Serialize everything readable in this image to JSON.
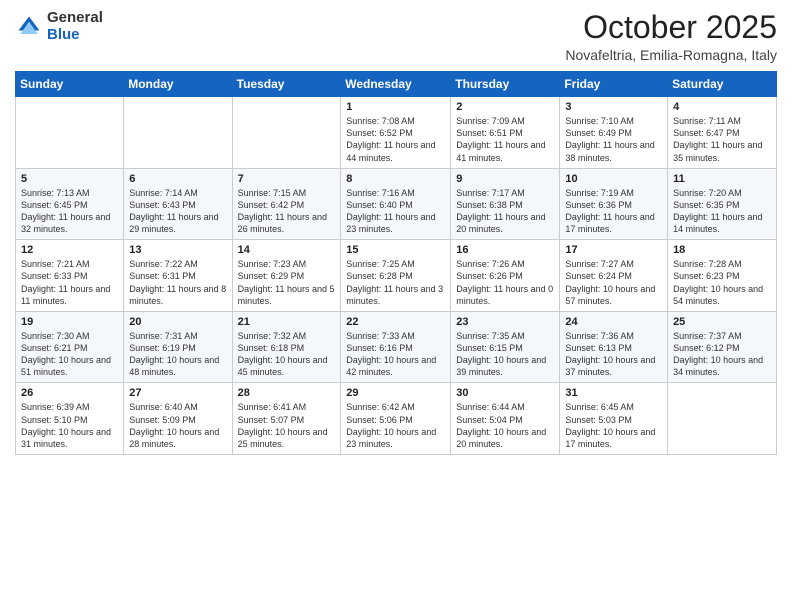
{
  "logo": {
    "general": "General",
    "blue": "Blue"
  },
  "header": {
    "month": "October 2025",
    "location": "Novafeltria, Emilia-Romagna, Italy"
  },
  "days_of_week": [
    "Sunday",
    "Monday",
    "Tuesday",
    "Wednesday",
    "Thursday",
    "Friday",
    "Saturday"
  ],
  "weeks": [
    [
      {
        "day": "",
        "content": ""
      },
      {
        "day": "",
        "content": ""
      },
      {
        "day": "",
        "content": ""
      },
      {
        "day": "1",
        "content": "Sunrise: 7:08 AM\nSunset: 6:52 PM\nDaylight: 11 hours and 44 minutes."
      },
      {
        "day": "2",
        "content": "Sunrise: 7:09 AM\nSunset: 6:51 PM\nDaylight: 11 hours and 41 minutes."
      },
      {
        "day": "3",
        "content": "Sunrise: 7:10 AM\nSunset: 6:49 PM\nDaylight: 11 hours and 38 minutes."
      },
      {
        "day": "4",
        "content": "Sunrise: 7:11 AM\nSunset: 6:47 PM\nDaylight: 11 hours and 35 minutes."
      }
    ],
    [
      {
        "day": "5",
        "content": "Sunrise: 7:13 AM\nSunset: 6:45 PM\nDaylight: 11 hours and 32 minutes."
      },
      {
        "day": "6",
        "content": "Sunrise: 7:14 AM\nSunset: 6:43 PM\nDaylight: 11 hours and 29 minutes."
      },
      {
        "day": "7",
        "content": "Sunrise: 7:15 AM\nSunset: 6:42 PM\nDaylight: 11 hours and 26 minutes."
      },
      {
        "day": "8",
        "content": "Sunrise: 7:16 AM\nSunset: 6:40 PM\nDaylight: 11 hours and 23 minutes."
      },
      {
        "day": "9",
        "content": "Sunrise: 7:17 AM\nSunset: 6:38 PM\nDaylight: 11 hours and 20 minutes."
      },
      {
        "day": "10",
        "content": "Sunrise: 7:19 AM\nSunset: 6:36 PM\nDaylight: 11 hours and 17 minutes."
      },
      {
        "day": "11",
        "content": "Sunrise: 7:20 AM\nSunset: 6:35 PM\nDaylight: 11 hours and 14 minutes."
      }
    ],
    [
      {
        "day": "12",
        "content": "Sunrise: 7:21 AM\nSunset: 6:33 PM\nDaylight: 11 hours and 11 minutes."
      },
      {
        "day": "13",
        "content": "Sunrise: 7:22 AM\nSunset: 6:31 PM\nDaylight: 11 hours and 8 minutes."
      },
      {
        "day": "14",
        "content": "Sunrise: 7:23 AM\nSunset: 6:29 PM\nDaylight: 11 hours and 5 minutes."
      },
      {
        "day": "15",
        "content": "Sunrise: 7:25 AM\nSunset: 6:28 PM\nDaylight: 11 hours and 3 minutes."
      },
      {
        "day": "16",
        "content": "Sunrise: 7:26 AM\nSunset: 6:26 PM\nDaylight: 11 hours and 0 minutes."
      },
      {
        "day": "17",
        "content": "Sunrise: 7:27 AM\nSunset: 6:24 PM\nDaylight: 10 hours and 57 minutes."
      },
      {
        "day": "18",
        "content": "Sunrise: 7:28 AM\nSunset: 6:23 PM\nDaylight: 10 hours and 54 minutes."
      }
    ],
    [
      {
        "day": "19",
        "content": "Sunrise: 7:30 AM\nSunset: 6:21 PM\nDaylight: 10 hours and 51 minutes."
      },
      {
        "day": "20",
        "content": "Sunrise: 7:31 AM\nSunset: 6:19 PM\nDaylight: 10 hours and 48 minutes."
      },
      {
        "day": "21",
        "content": "Sunrise: 7:32 AM\nSunset: 6:18 PM\nDaylight: 10 hours and 45 minutes."
      },
      {
        "day": "22",
        "content": "Sunrise: 7:33 AM\nSunset: 6:16 PM\nDaylight: 10 hours and 42 minutes."
      },
      {
        "day": "23",
        "content": "Sunrise: 7:35 AM\nSunset: 6:15 PM\nDaylight: 10 hours and 39 minutes."
      },
      {
        "day": "24",
        "content": "Sunrise: 7:36 AM\nSunset: 6:13 PM\nDaylight: 10 hours and 37 minutes."
      },
      {
        "day": "25",
        "content": "Sunrise: 7:37 AM\nSunset: 6:12 PM\nDaylight: 10 hours and 34 minutes."
      }
    ],
    [
      {
        "day": "26",
        "content": "Sunrise: 6:39 AM\nSunset: 5:10 PM\nDaylight: 10 hours and 31 minutes."
      },
      {
        "day": "27",
        "content": "Sunrise: 6:40 AM\nSunset: 5:09 PM\nDaylight: 10 hours and 28 minutes."
      },
      {
        "day": "28",
        "content": "Sunrise: 6:41 AM\nSunset: 5:07 PM\nDaylight: 10 hours and 25 minutes."
      },
      {
        "day": "29",
        "content": "Sunrise: 6:42 AM\nSunset: 5:06 PM\nDaylight: 10 hours and 23 minutes."
      },
      {
        "day": "30",
        "content": "Sunrise: 6:44 AM\nSunset: 5:04 PM\nDaylight: 10 hours and 20 minutes."
      },
      {
        "day": "31",
        "content": "Sunrise: 6:45 AM\nSunset: 5:03 PM\nDaylight: 10 hours and 17 minutes."
      },
      {
        "day": "",
        "content": ""
      }
    ]
  ]
}
